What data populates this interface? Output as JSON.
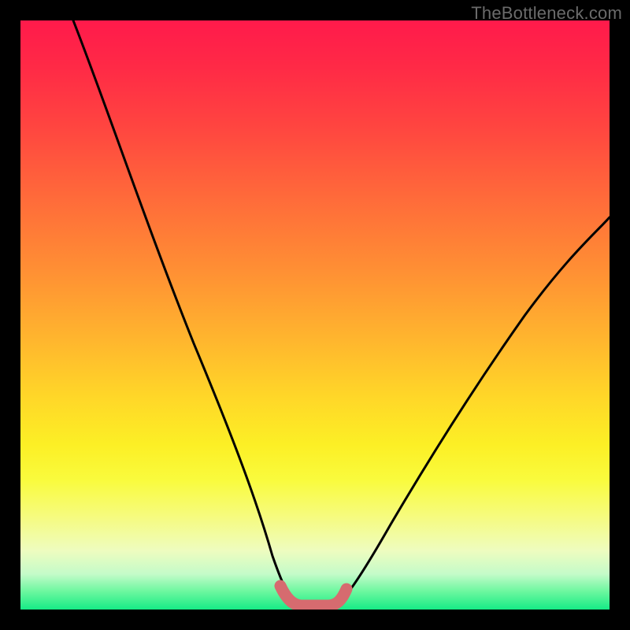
{
  "watermark": "TheBottleneck.com",
  "chart_data": {
    "type": "line",
    "title": "",
    "xlabel": "",
    "ylabel": "",
    "xlim": [
      0,
      100
    ],
    "ylim": [
      0,
      100
    ],
    "grid": false,
    "series": [
      {
        "name": "left-curve",
        "x": [
          9,
          14,
          20,
          26,
          32,
          37,
          41,
          44,
          46,
          47
        ],
        "values": [
          100,
          84,
          67,
          50,
          33,
          18,
          8,
          3,
          1,
          1
        ]
      },
      {
        "name": "right-curve",
        "x": [
          53,
          55,
          58,
          63,
          70,
          78,
          86,
          94,
          100
        ],
        "values": [
          1,
          1,
          4,
          11,
          22,
          35,
          47,
          58,
          67
        ]
      },
      {
        "name": "trough-highlight",
        "x": [
          44,
          46,
          48,
          50,
          52,
          54,
          55
        ],
        "values": [
          4,
          1.2,
          0.8,
          0.8,
          0.8,
          1.2,
          3
        ]
      }
    ],
    "colors": {
      "curve": "#000000",
      "trough": "#d66b6f",
      "gradient_top": "#ff1a4b",
      "gradient_bottom": "#16eb86"
    }
  }
}
